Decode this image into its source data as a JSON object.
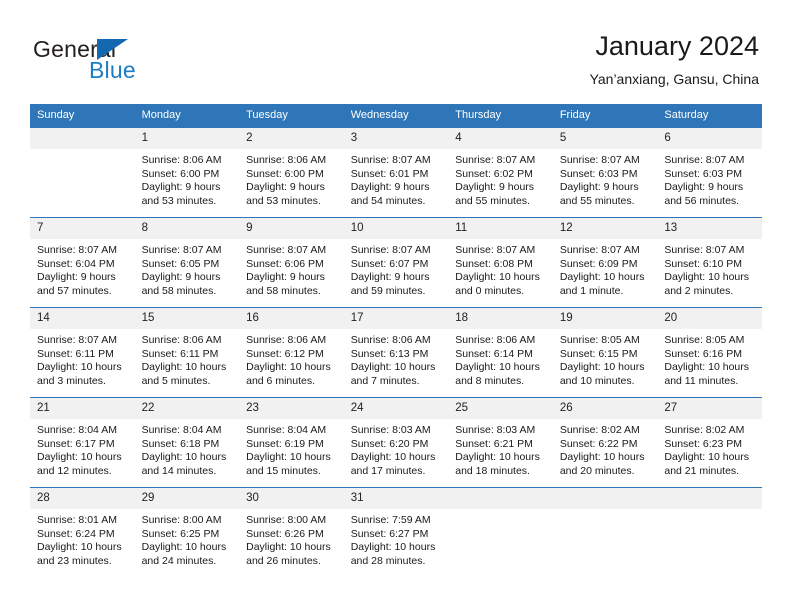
{
  "brand": {
    "name_part1": "General",
    "name_part2": "Blue",
    "triangle_icon": "blue-triangle-icon",
    "accent_color": "#1468b0",
    "text_color": "#231f20"
  },
  "header": {
    "title": "January 2024",
    "location": "Yan’anxiang, Gansu, China"
  },
  "theme": {
    "header_blue": "#2e76b8",
    "daynum_band": "#f1f1f1",
    "body_text": "#1a1a1a"
  },
  "weekdays": [
    "Sunday",
    "Monday",
    "Tuesday",
    "Wednesday",
    "Thursday",
    "Friday",
    "Saturday"
  ],
  "weeks": [
    [
      {
        "day": "",
        "sunrise": "",
        "sunset": "",
        "daylight_line1": "",
        "daylight_line2": ""
      },
      {
        "day": "1",
        "sunrise": "Sunrise: 8:06 AM",
        "sunset": "Sunset: 6:00 PM",
        "daylight_line1": "Daylight: 9 hours",
        "daylight_line2": "and 53 minutes."
      },
      {
        "day": "2",
        "sunrise": "Sunrise: 8:06 AM",
        "sunset": "Sunset: 6:00 PM",
        "daylight_line1": "Daylight: 9 hours",
        "daylight_line2": "and 53 minutes."
      },
      {
        "day": "3",
        "sunrise": "Sunrise: 8:07 AM",
        "sunset": "Sunset: 6:01 PM",
        "daylight_line1": "Daylight: 9 hours",
        "daylight_line2": "and 54 minutes."
      },
      {
        "day": "4",
        "sunrise": "Sunrise: 8:07 AM",
        "sunset": "Sunset: 6:02 PM",
        "daylight_line1": "Daylight: 9 hours",
        "daylight_line2": "and 55 minutes."
      },
      {
        "day": "5",
        "sunrise": "Sunrise: 8:07 AM",
        "sunset": "Sunset: 6:03 PM",
        "daylight_line1": "Daylight: 9 hours",
        "daylight_line2": "and 55 minutes."
      },
      {
        "day": "6",
        "sunrise": "Sunrise: 8:07 AM",
        "sunset": "Sunset: 6:03 PM",
        "daylight_line1": "Daylight: 9 hours",
        "daylight_line2": "and 56 minutes."
      }
    ],
    [
      {
        "day": "7",
        "sunrise": "Sunrise: 8:07 AM",
        "sunset": "Sunset: 6:04 PM",
        "daylight_line1": "Daylight: 9 hours",
        "daylight_line2": "and 57 minutes."
      },
      {
        "day": "8",
        "sunrise": "Sunrise: 8:07 AM",
        "sunset": "Sunset: 6:05 PM",
        "daylight_line1": "Daylight: 9 hours",
        "daylight_line2": "and 58 minutes."
      },
      {
        "day": "9",
        "sunrise": "Sunrise: 8:07 AM",
        "sunset": "Sunset: 6:06 PM",
        "daylight_line1": "Daylight: 9 hours",
        "daylight_line2": "and 58 minutes."
      },
      {
        "day": "10",
        "sunrise": "Sunrise: 8:07 AM",
        "sunset": "Sunset: 6:07 PM",
        "daylight_line1": "Daylight: 9 hours",
        "daylight_line2": "and 59 minutes."
      },
      {
        "day": "11",
        "sunrise": "Sunrise: 8:07 AM",
        "sunset": "Sunset: 6:08 PM",
        "daylight_line1": "Daylight: 10 hours",
        "daylight_line2": "and 0 minutes."
      },
      {
        "day": "12",
        "sunrise": "Sunrise: 8:07 AM",
        "sunset": "Sunset: 6:09 PM",
        "daylight_line1": "Daylight: 10 hours",
        "daylight_line2": "and 1 minute."
      },
      {
        "day": "13",
        "sunrise": "Sunrise: 8:07 AM",
        "sunset": "Sunset: 6:10 PM",
        "daylight_line1": "Daylight: 10 hours",
        "daylight_line2": "and 2 minutes."
      }
    ],
    [
      {
        "day": "14",
        "sunrise": "Sunrise: 8:07 AM",
        "sunset": "Sunset: 6:11 PM",
        "daylight_line1": "Daylight: 10 hours",
        "daylight_line2": "and 3 minutes."
      },
      {
        "day": "15",
        "sunrise": "Sunrise: 8:06 AM",
        "sunset": "Sunset: 6:11 PM",
        "daylight_line1": "Daylight: 10 hours",
        "daylight_line2": "and 5 minutes."
      },
      {
        "day": "16",
        "sunrise": "Sunrise: 8:06 AM",
        "sunset": "Sunset: 6:12 PM",
        "daylight_line1": "Daylight: 10 hours",
        "daylight_line2": "and 6 minutes."
      },
      {
        "day": "17",
        "sunrise": "Sunrise: 8:06 AM",
        "sunset": "Sunset: 6:13 PM",
        "daylight_line1": "Daylight: 10 hours",
        "daylight_line2": "and 7 minutes."
      },
      {
        "day": "18",
        "sunrise": "Sunrise: 8:06 AM",
        "sunset": "Sunset: 6:14 PM",
        "daylight_line1": "Daylight: 10 hours",
        "daylight_line2": "and 8 minutes."
      },
      {
        "day": "19",
        "sunrise": "Sunrise: 8:05 AM",
        "sunset": "Sunset: 6:15 PM",
        "daylight_line1": "Daylight: 10 hours",
        "daylight_line2": "and 10 minutes."
      },
      {
        "day": "20",
        "sunrise": "Sunrise: 8:05 AM",
        "sunset": "Sunset: 6:16 PM",
        "daylight_line1": "Daylight: 10 hours",
        "daylight_line2": "and 11 minutes."
      }
    ],
    [
      {
        "day": "21",
        "sunrise": "Sunrise: 8:04 AM",
        "sunset": "Sunset: 6:17 PM",
        "daylight_line1": "Daylight: 10 hours",
        "daylight_line2": "and 12 minutes."
      },
      {
        "day": "22",
        "sunrise": "Sunrise: 8:04 AM",
        "sunset": "Sunset: 6:18 PM",
        "daylight_line1": "Daylight: 10 hours",
        "daylight_line2": "and 14 minutes."
      },
      {
        "day": "23",
        "sunrise": "Sunrise: 8:04 AM",
        "sunset": "Sunset: 6:19 PM",
        "daylight_line1": "Daylight: 10 hours",
        "daylight_line2": "and 15 minutes."
      },
      {
        "day": "24",
        "sunrise": "Sunrise: 8:03 AM",
        "sunset": "Sunset: 6:20 PM",
        "daylight_line1": "Daylight: 10 hours",
        "daylight_line2": "and 17 minutes."
      },
      {
        "day": "25",
        "sunrise": "Sunrise: 8:03 AM",
        "sunset": "Sunset: 6:21 PM",
        "daylight_line1": "Daylight: 10 hours",
        "daylight_line2": "and 18 minutes."
      },
      {
        "day": "26",
        "sunrise": "Sunrise: 8:02 AM",
        "sunset": "Sunset: 6:22 PM",
        "daylight_line1": "Daylight: 10 hours",
        "daylight_line2": "and 20 minutes."
      },
      {
        "day": "27",
        "sunrise": "Sunrise: 8:02 AM",
        "sunset": "Sunset: 6:23 PM",
        "daylight_line1": "Daylight: 10 hours",
        "daylight_line2": "and 21 minutes."
      }
    ],
    [
      {
        "day": "28",
        "sunrise": "Sunrise: 8:01 AM",
        "sunset": "Sunset: 6:24 PM",
        "daylight_line1": "Daylight: 10 hours",
        "daylight_line2": "and 23 minutes."
      },
      {
        "day": "29",
        "sunrise": "Sunrise: 8:00 AM",
        "sunset": "Sunset: 6:25 PM",
        "daylight_line1": "Daylight: 10 hours",
        "daylight_line2": "and 24 minutes."
      },
      {
        "day": "30",
        "sunrise": "Sunrise: 8:00 AM",
        "sunset": "Sunset: 6:26 PM",
        "daylight_line1": "Daylight: 10 hours",
        "daylight_line2": "and 26 minutes."
      },
      {
        "day": "31",
        "sunrise": "Sunrise: 7:59 AM",
        "sunset": "Sunset: 6:27 PM",
        "daylight_line1": "Daylight: 10 hours",
        "daylight_line2": "and 28 minutes."
      },
      {
        "day": "",
        "sunrise": "",
        "sunset": "",
        "daylight_line1": "",
        "daylight_line2": ""
      },
      {
        "day": "",
        "sunrise": "",
        "sunset": "",
        "daylight_line1": "",
        "daylight_line2": ""
      },
      {
        "day": "",
        "sunrise": "",
        "sunset": "",
        "daylight_line1": "",
        "daylight_line2": ""
      }
    ]
  ]
}
